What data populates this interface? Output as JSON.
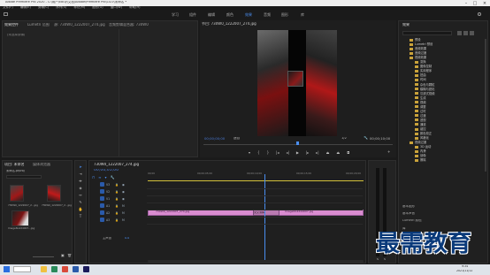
{
  "window": {
    "title": "Adobe Premiere Pro 2020 - C:\\用户\\Ebuy\\文档\\Adobe\\Premiere Pro\\14.0\\未命名 *"
  },
  "menu": [
    "文件(F)",
    "编辑(E)",
    "剪辑(C)",
    "序列(S)",
    "标记(M)",
    "图形(G)",
    "窗口(W)",
    "帮助(H)"
  ],
  "workspaces": [
    "学习",
    "组件",
    "编辑",
    "颜色",
    "效果",
    "音频",
    "图形",
    "库"
  ],
  "active_workspace": "效果",
  "left_panel": {
    "tabs": [
      "效果控件",
      "Lumetri 范围",
      "源: 730W0_1222007_274.jpg",
      "音频剪辑混合器: 730W0"
    ],
    "status": "(未选择剪辑)"
  },
  "program": {
    "title": "节目: 730W0_1222007_274.jpg",
    "timecode_left": "00;00;00;00",
    "fit": "适合",
    "ratio": "1/2",
    "timecode_right": "00;00;10;00"
  },
  "effects": {
    "title": "效果",
    "items": [
      "预设",
      "Lumetri 预设",
      "音频效果",
      "音频过渡",
      "视频效果",
      "变换",
      "图像控制",
      "实用程序",
      "扭曲",
      "时间",
      "杂色与颗粒",
      "模糊与锐化",
      "沉浸式视频",
      "生成",
      "视频",
      "调整",
      "过时",
      "过渡",
      "透视",
      "通道",
      "键控",
      "颜色校正",
      "风格化",
      "视频过渡",
      "3D 运动",
      "内滑",
      "划像",
      "擦除"
    ],
    "bottom": [
      "基本图形",
      "基本声音",
      "Lumetri 颜色",
      "库",
      "标记",
      "历史记录",
      "信息"
    ]
  },
  "project": {
    "tabs": [
      "项目: 未命名",
      "媒体浏览器"
    ],
    "search": "未命名.prproj",
    "items": [
      "730W0_1222007_2...jpg",
      "730W0_1222007_2...jpg",
      "ImageNo224007...jpg"
    ]
  },
  "timeline": {
    "title": "730W0_1222007_274.jpg",
    "timecode": "00;00;05;00",
    "ruler": [
      "00;00",
      "00;00;05;00",
      "00;00;10;00",
      "00;00;15;00",
      "00;00;20;00"
    ],
    "tracks": [
      "V3",
      "V2",
      "V1",
      "A1",
      "A2",
      "A3"
    ],
    "master": "主声道",
    "master_val": "0.0",
    "clip_a": "730W0_1222007_274.jpg",
    "clip_b": "ImageNo2244007.jpg",
    "transition": "交叉溶解"
  },
  "taskbar": {
    "time": "9:34",
    "date": "2021/11/12"
  },
  "watermark": "最需教育"
}
